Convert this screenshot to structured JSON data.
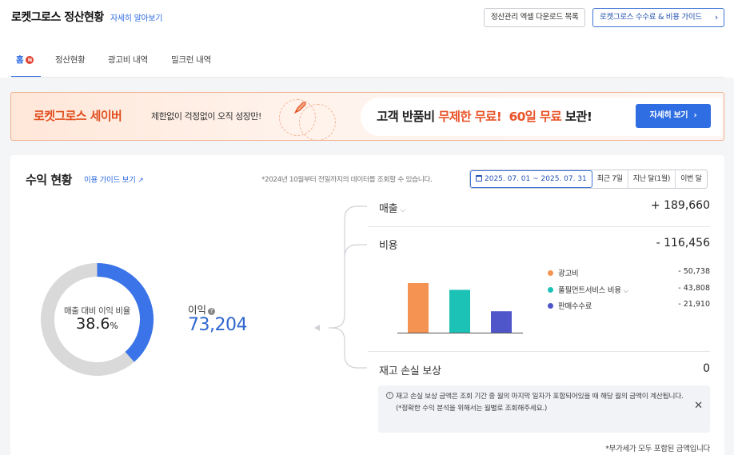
{
  "header": {
    "title": "로켓그로스 정산현황",
    "title_link": "자세히 알아보기",
    "btn_excel": "정산관리 엑셀 다운로드 목록",
    "btn_guide": "로켓그로스 수수료 & 비용 가이드",
    "tabs": [
      {
        "label": "홈",
        "badge": "N"
      },
      {
        "label": "정산현황"
      },
      {
        "label": "광고비 내역"
      },
      {
        "label": "밀크런 내역"
      }
    ]
  },
  "banner": {
    "brand": "로켓그로스 세이버",
    "sub": "제한없이 걱정없이 오직 성장만!",
    "main_1": "고객 반품비 ",
    "main_hl1": "무제한 무료!",
    "main_2": "  ",
    "main_hl2": "60일 무료",
    "main_3": " 보관!",
    "button": "자세히 보기"
  },
  "summary": {
    "title": "수익 현황",
    "guide_link": "이용 가이드 보기",
    "notice": "*2024년 10월부터 전일까지의 데이터를 조회할 수 있습니다.",
    "date_range": "2025. 07. 01 ~ 2025. 07. 31",
    "period_buttons": [
      "최근 7일",
      "지난 달(1월)",
      "이번 달"
    ],
    "ratio_label": "매출 대비 이익 비율",
    "ratio_value": "38.6",
    "ratio_unit": "%",
    "ratio_fraction": 0.386,
    "profit_label": "이익",
    "profit_value": "73,204",
    "sales_label": "매출",
    "sales_value": "+ 189,660",
    "cost_label": "비용",
    "cost_value": "- 116,456",
    "cost_items": [
      {
        "label": "광고비",
        "value": "- 50,738",
        "amount": 50738,
        "color": "#f59352"
      },
      {
        "label": "풀필먼트서비스 비용",
        "value": "- 43,808",
        "amount": 43808,
        "color": "#1cc2b5"
      },
      {
        "label": "판매수수료",
        "value": "- 21,910",
        "amount": 21910,
        "color": "#4f56c9"
      }
    ],
    "inventory_label": "재고 손실 보상",
    "inventory_value": "0",
    "info_line1": "재고 손실 보상 금액은 조회 기간 중 월의 마지막 일자가 포함되어있을 때 해당 월의 금액이 계산됩니다.",
    "info_line2": "(*정확한 수익 분석을 위해서는 월별로 조회해주세요.)",
    "vat_note": "*부가세가 모두 포함된 금액입니다"
  },
  "colors": {
    "accent": "#2d6be0",
    "donut_fill": "#3b74e8",
    "donut_track": "#d9d9d9",
    "brand_orange": "#e0501f"
  }
}
